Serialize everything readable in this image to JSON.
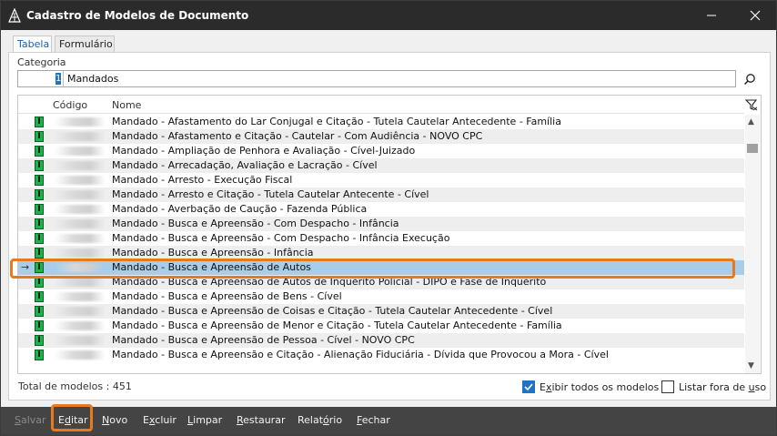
{
  "window": {
    "title": "Cadastro de Modelos de Documento",
    "minimize_glyph": "—",
    "close_glyph": "✕"
  },
  "tabs": [
    {
      "label": "Tabela",
      "active": true
    },
    {
      "label": "Formulário",
      "active": false
    }
  ],
  "categoria": {
    "label": "Categoria",
    "code": "1",
    "value": "Mandados"
  },
  "grid": {
    "columns": {
      "code": "Código",
      "name": "Nome"
    },
    "selected_index": 10,
    "current_row_indicator": "→",
    "flag_letter": "I",
    "rows": [
      "Mandado - Afastamento do Lar Conjugal e Citação - Tutela Cautelar Antecedente - Família",
      "Mandado - Afastamento e Citação - Cautelar - Com Audiência - NOVO CPC",
      "Mandado - Ampliação de Penhora e Avaliação - Cível-Juizado",
      "Mandado - Arrecadação, Avaliação e Lacração - Cível",
      "Mandado - Arresto - Execução Fiscal",
      "Mandado - Arresto e Citação - Tutela Cautelar Antecente - Cível",
      "Mandado - Averbação de Caução - Fazenda Pública",
      "Mandado - Busca e Apreensão - Com Despacho - Infância",
      "Mandado - Busca e Apreensão - Com Despacho - Infância Execução",
      "Mandado - Busca e Apreensão - Infância",
      "Mandado - Busca e Apreensão de Autos",
      "Mandado - Busca e Apreensão de Autos de Inquérito Policial - DIPO e Fase de Inquérito",
      "Mandado - Busca e Apreensão de Bens - Cível",
      "Mandado - Busca e Apreensão de Coisas e Citação - Tutela Cautelar Antecedente - Cível",
      "Mandado - Busca e Apreensão de Menor e Citação - Tutela Cautelar Antecedente - Família",
      "Mandado - Busca e Apreensão de Pessoa - Cível - NOVO CPC",
      "Mandado - Busca e Apreensão e Citação - Alienação Fiduciária - Dívida que Provocou a Mora - Cível"
    ]
  },
  "footer": {
    "total_label": "Total de modelos : 451",
    "exibir_todos": {
      "label_pre": "E",
      "label_u": "x",
      "label_post": "ibir todos os modelos",
      "checked": true
    },
    "listar_fora": {
      "label_pre": "Listar fora de ",
      "label_u": "u",
      "label_post": "so",
      "checked": false
    }
  },
  "toolbar": {
    "salvar": {
      "pre": "",
      "u": "S",
      "post": "alvar"
    },
    "editar": {
      "pre": "E",
      "u": "d",
      "post": "itar"
    },
    "novo": {
      "pre": "",
      "u": "N",
      "post": "ovo"
    },
    "excluir": {
      "pre": "E",
      "u": "x",
      "post": "cluir"
    },
    "limpar": {
      "pre": "",
      "u": "L",
      "post": "impar"
    },
    "restaurar": {
      "pre": "",
      "u": "R",
      "post": "estaurar"
    },
    "relatorio": {
      "pre": "Relat",
      "u": "ó",
      "post": "rio"
    },
    "fechar": {
      "pre": "",
      "u": "F",
      "post": "echar"
    }
  },
  "colors": {
    "selection": "#a9cde9",
    "highlight_ring": "#e87a1d",
    "flag_green": "#1db34a",
    "checkbox_blue": "#1e73c7"
  }
}
